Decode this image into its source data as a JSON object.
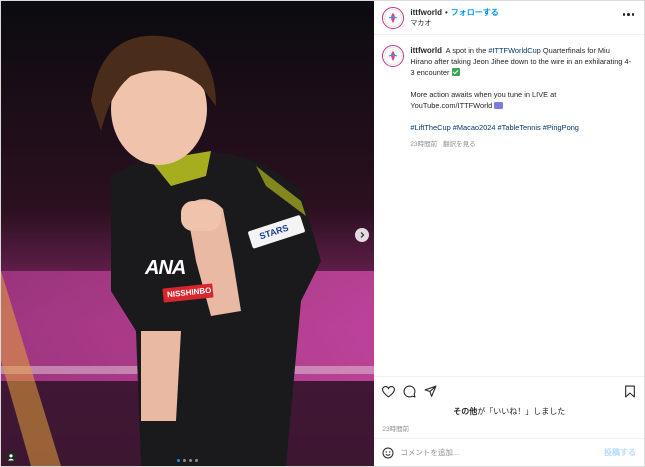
{
  "post": {
    "username": "ittfworld",
    "separator": "•",
    "follow_label": "フォローする",
    "location": "マカオ",
    "more_icon": "more-horizontal-icon"
  },
  "caption": {
    "username": "ittfworld",
    "text_1": "A spot in the ",
    "tag_world_cup": "#ITTFWorldCup",
    "text_2": " Quarterfinals for Miu Hirano after taking Jeon Jihee down to the wire in an exhilarating 4-3 encounter",
    "para2_text": "More action awaits when you tune in LIVE at YouTube.com/ITTFWorld",
    "hashtags": [
      "#LiftTheCup",
      "#Macao2024",
      "#TableTennis",
      "#PingPong"
    ],
    "time": "23時間前",
    "translate_label": "翻訳を見る"
  },
  "actions": {
    "like_icon": "heart-icon",
    "comment_icon": "comment-icon",
    "share_icon": "share-icon",
    "save_icon": "bookmark-icon"
  },
  "likes": {
    "who": "その他",
    "text": "が「いいね！」しました"
  },
  "post_time": "23時間前",
  "comment": {
    "placeholder": "コメントを追加...",
    "post_label": "投稿する"
  },
  "media": {
    "jersey_sponsor_1": "ANA",
    "jersey_sponsor_2": "NISSHINBO",
    "jersey_sponsor_3": "STARS",
    "carousel_count": 4,
    "carousel_active": 0
  }
}
